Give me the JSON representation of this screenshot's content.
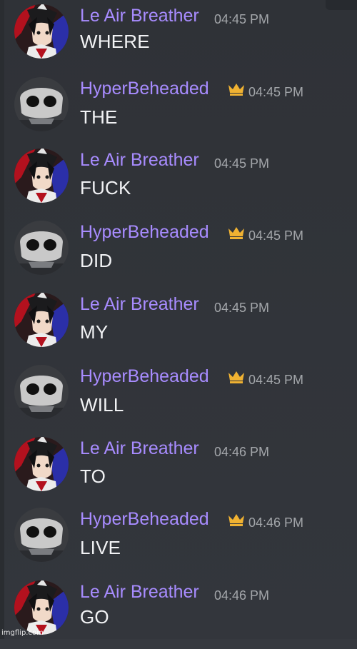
{
  "users": {
    "le_air_breather": {
      "name": "Le Air Breather",
      "name_color": "#a88cff",
      "avatar_icon": "anime-character-avatar"
    },
    "hyper_beheaded": {
      "name": "HyperBeheaded",
      "name_color": "#a88cff",
      "badge_icon": "crown-icon",
      "badge_color": "#f0b232",
      "avatar_icon": "skull-mask-avatar"
    }
  },
  "messages": [
    {
      "author": "Le Air Breather",
      "time": "04:45 PM",
      "text": "WHERE"
    },
    {
      "author": "HyperBeheaded",
      "time": "04:45 PM",
      "text": "THE"
    },
    {
      "author": "Le Air Breather",
      "time": "04:45 PM",
      "text": "FUCK"
    },
    {
      "author": "HyperBeheaded",
      "time": "04:45 PM",
      "text": "DID"
    },
    {
      "author": "Le Air Breather",
      "time": "04:45 PM",
      "text": "MY"
    },
    {
      "author": "HyperBeheaded",
      "time": "04:45 PM",
      "text": "WILL"
    },
    {
      "author": "Le Air Breather",
      "time": "04:46 PM",
      "text": "TO"
    },
    {
      "author": "HyperBeheaded",
      "time": "04:46 PM",
      "text": "LIVE"
    },
    {
      "author": "Le Air Breather",
      "time": "04:46 PM",
      "text": "GO"
    }
  ],
  "watermark": "imgflip.com",
  "colors": {
    "background": "#36393f",
    "message_text": "#f2f3f5",
    "timestamp": "#a3a6aa"
  }
}
